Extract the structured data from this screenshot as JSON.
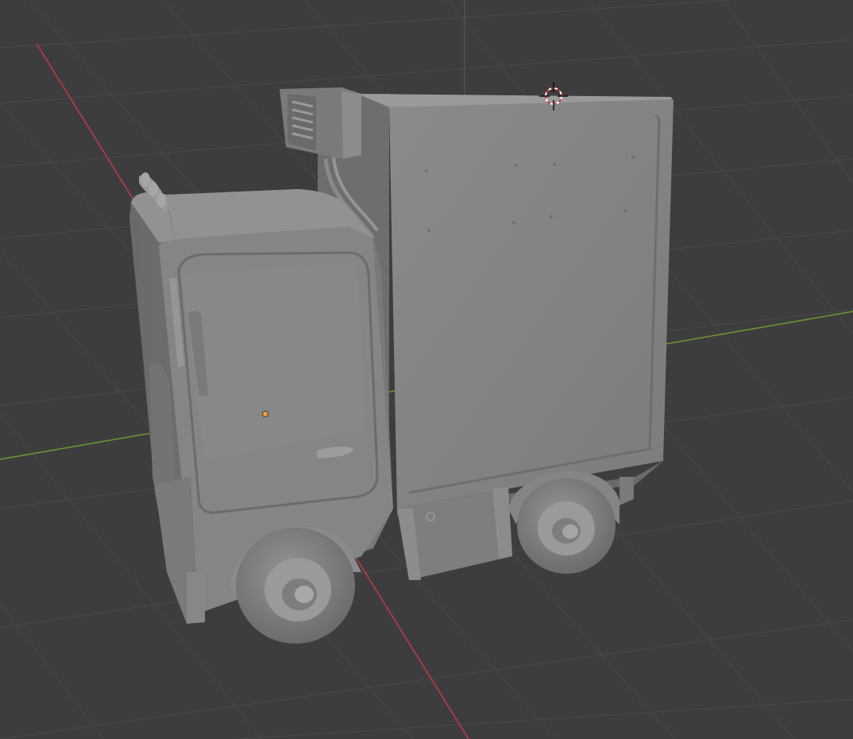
{
  "app": {
    "type": "3d-viewport"
  },
  "scene": {
    "object": "refrigerated-truck-model",
    "shading": "solid",
    "background_color": "#3d3d3d",
    "grid_color": "#4a4a4a",
    "x_axis_color": "#c23a48",
    "y_axis_color": "#6f9a2e",
    "model_color": "#828282",
    "origin_color": "#f0a030",
    "cursor_icon": "3d-cursor-icon"
  }
}
